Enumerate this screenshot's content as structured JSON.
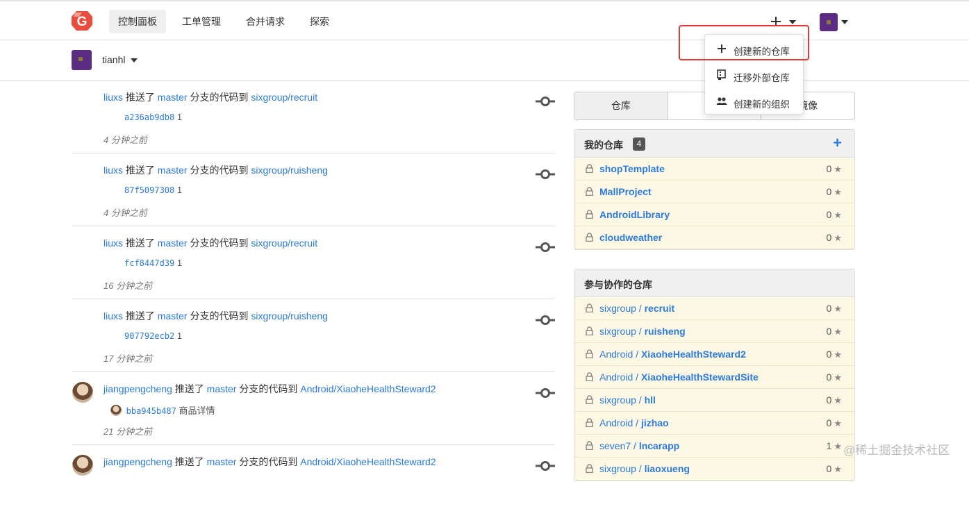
{
  "nav": {
    "items": [
      {
        "label": "控制面板",
        "active": true
      },
      {
        "label": "工单管理"
      },
      {
        "label": "合并请求"
      },
      {
        "label": "探索"
      }
    ]
  },
  "header": {
    "plus_icon": "plus-icon",
    "brand_color": "#e74c3c"
  },
  "dropdown": {
    "items": [
      {
        "icon": "plus-icon",
        "label": "创建新的仓库"
      },
      {
        "icon": "repo-clone-icon",
        "label": "迁移外部仓库"
      },
      {
        "icon": "organization-icon",
        "label": "创建新的组织"
      }
    ]
  },
  "context": {
    "username": "tianhl"
  },
  "feed": [
    {
      "user": "liuxs",
      "verb": "推送了",
      "branch": "master",
      "mid": "分支的代码到",
      "repo": "sixgroup/recruit",
      "sha": "a236ab9db8",
      "msg": "1",
      "time": "4 分钟之前",
      "has_avatar": false
    },
    {
      "user": "liuxs",
      "verb": "推送了",
      "branch": "master",
      "mid": "分支的代码到",
      "repo": "sixgroup/ruisheng",
      "sha": "87f5097308",
      "msg": "1",
      "time": "4 分钟之前",
      "has_avatar": false
    },
    {
      "user": "liuxs",
      "verb": "推送了",
      "branch": "master",
      "mid": "分支的代码到",
      "repo": "sixgroup/recruit",
      "sha": "fcf8447d39",
      "msg": "1",
      "time": "16 分钟之前",
      "has_avatar": false
    },
    {
      "user": "liuxs",
      "verb": "推送了",
      "branch": "master",
      "mid": "分支的代码到",
      "repo": "sixgroup/ruisheng",
      "sha": "907792ecb2",
      "msg": "1",
      "time": "17 分钟之前",
      "has_avatar": false
    },
    {
      "user": "jiangpengcheng",
      "verb": "推送了",
      "branch": "master",
      "mid": "分支的代码到",
      "repo": "Android/XiaoheHealthSteward2",
      "sha": "bba945b487",
      "msg": "商品详情",
      "time": "21 分钟之前",
      "has_avatar": true
    },
    {
      "user": "jiangpengcheng",
      "verb": "推送了",
      "branch": "master",
      "mid": "分支的代码到",
      "repo": "Android/XiaoheHealthSteward2",
      "sha": "",
      "msg": "",
      "time": "",
      "has_avatar": true
    }
  ],
  "tabs": [
    {
      "label": "仓库",
      "active": true
    },
    {
      "label": ""
    },
    {
      "label": "镜像"
    }
  ],
  "my_repos": {
    "title": "我的仓库",
    "count": "4",
    "add_label": "+",
    "items": [
      {
        "owner": "",
        "name": "shopTemplate",
        "stars": "0"
      },
      {
        "owner": "",
        "name": "MallProject",
        "stars": "0"
      },
      {
        "owner": "",
        "name": "AndroidLibrary",
        "stars": "0"
      },
      {
        "owner": "",
        "name": "cloudweather",
        "stars": "0"
      }
    ]
  },
  "collab_repos": {
    "title": "参与协作的仓库",
    "items": [
      {
        "owner": "sixgroup / ",
        "name": "recruit",
        "stars": "0"
      },
      {
        "owner": "sixgroup / ",
        "name": "ruisheng",
        "stars": "0"
      },
      {
        "owner": "Android / ",
        "name": "XiaoheHealthSteward2",
        "stars": "0"
      },
      {
        "owner": "Android / ",
        "name": "XiaoheHealthStewardSite",
        "stars": "0"
      },
      {
        "owner": "sixgroup / ",
        "name": "hll",
        "stars": "0"
      },
      {
        "owner": "Android / ",
        "name": "jizhao",
        "stars": "0"
      },
      {
        "owner": "seven7 / ",
        "name": "lncarapp",
        "stars": "1"
      },
      {
        "owner": "sixgroup / ",
        "name": "liaoxueng",
        "stars": "0"
      }
    ]
  },
  "star_glyph": "★",
  "watermark": "@稀土掘金技术社区"
}
